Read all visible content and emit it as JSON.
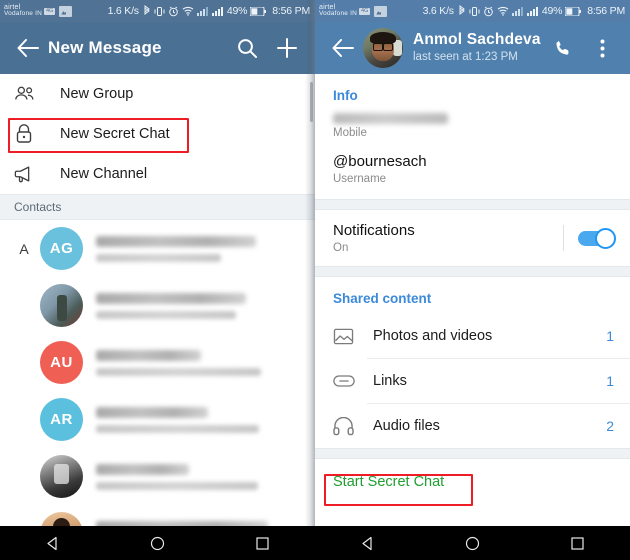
{
  "left": {
    "statusbar": {
      "carrier_line1": "airtel",
      "carrier_line2": "Vodafone IN",
      "speed": "1.6 K/s",
      "battery": "49%",
      "time": "8:56 PM"
    },
    "appbar": {
      "title": "New Message",
      "back_icon": "back-arrow-icon",
      "search_icon": "search-icon",
      "add_icon": "plus-icon"
    },
    "menu": [
      {
        "label": "New Group",
        "icon": "group-icon"
      },
      {
        "label": "New Secret Chat",
        "icon": "lock-icon",
        "highlighted": true
      },
      {
        "label": "New Channel",
        "icon": "megaphone-icon"
      }
    ],
    "contacts_header": "Contacts",
    "index_letter": "A",
    "contacts": [
      {
        "initials": "AG",
        "avatar_type": "initials",
        "avatar_color": "#69c1dd"
      },
      {
        "initials": "",
        "avatar_type": "photo",
        "avatar_color": ""
      },
      {
        "initials": "AU",
        "avatar_type": "initials",
        "avatar_color": "#ef5f54"
      },
      {
        "initials": "AR",
        "avatar_type": "initials",
        "avatar_color": "#5bc0de"
      },
      {
        "initials": "",
        "avatar_type": "photo",
        "avatar_color": ""
      },
      {
        "initials": "",
        "avatar_type": "photo",
        "avatar_color": ""
      }
    ]
  },
  "right": {
    "statusbar": {
      "carrier_line1": "airtel",
      "carrier_line2": "Vodafone IN",
      "speed": "3.6 K/s",
      "battery": "49%",
      "time": "8:56 PM"
    },
    "appbar": {
      "name": "Anmol Sachdeva",
      "status": "last seen at 1:23 PM",
      "back_icon": "back-arrow-icon",
      "call_icon": "phone-icon",
      "overflow_icon": "more-vertical-icon"
    },
    "info": {
      "section_title": "Info",
      "phone_label": "Mobile",
      "username_value": "@bournesach",
      "username_label": "Username"
    },
    "notifications": {
      "title": "Notifications",
      "value": "On",
      "toggle_on": true
    },
    "shared": {
      "section_title": "Shared content",
      "items": [
        {
          "label": "Photos and videos",
          "count": "1",
          "icon": "image-icon"
        },
        {
          "label": "Links",
          "count": "1",
          "icon": "link-icon"
        },
        {
          "label": "Audio files",
          "count": "2",
          "icon": "headphones-icon"
        }
      ]
    },
    "secret_chat": {
      "label": "Start Secret Chat",
      "highlighted": true
    }
  },
  "navbar": {
    "back_icon": "nav-back-icon",
    "home_icon": "nav-home-icon",
    "recents_icon": "nav-recents-icon"
  },
  "colors": {
    "left_appbar": "#4a7093",
    "right_appbar": "#5080ad",
    "accent_blue": "#3c8ad9",
    "highlight_red": "#ee1c25",
    "secret_green": "#1f9f2f",
    "toggle_blue": "#4aa8ef"
  }
}
